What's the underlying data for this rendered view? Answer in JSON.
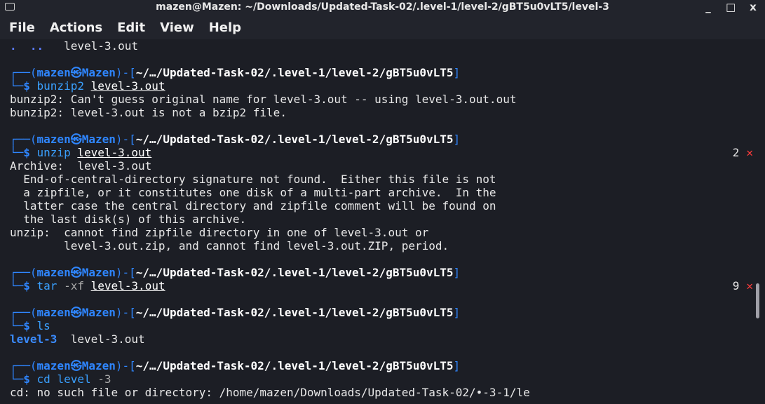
{
  "window": {
    "title": "mazen@Mazen: ~/Downloads/Updated-Task-02/.level-1/level-2/gBT5u0vLT5/level-3",
    "controls": [
      "_",
      "□",
      "x"
    ]
  },
  "menu": [
    "File",
    "Actions",
    "Edit",
    "View",
    "Help"
  ],
  "terminal": {
    "prompt_user": "mazen",
    "prompt_host": "Mazen",
    "prompt_at": "㉿",
    "prompt_path": "~/…/Updated-Task-02/.level-1/level-2/gBT5u0vLT5",
    "top_line": {
      "dots": ".  ..",
      "file": "level-3.out"
    },
    "blocks": [
      {
        "cmd": "bunzip2",
        "arg": "level-3.out",
        "status": "",
        "output": [
          "bunzip2: Can't guess original name for level-3.out -- using level-3.out.out",
          "bunzip2: level-3.out is not a bzip2 file."
        ]
      },
      {
        "cmd": "unzip",
        "arg": "level-3.out",
        "status": "2",
        "output": [
          "Archive:  level-3.out",
          "  End-of-central-directory signature not found.  Either this file is not",
          "  a zipfile, or it constitutes one disk of a multi-part archive.  In the",
          "  latter case the central directory and zipfile comment will be found on",
          "  the last disk(s) of this archive.",
          "unzip:  cannot find zipfile directory in one of level-3.out or",
          "        level-3.out.zip, and cannot find level-3.out.ZIP, period."
        ]
      },
      {
        "cmd": "tar",
        "arg": "level-3.out",
        "flag": "-xf",
        "status": "9",
        "output": []
      },
      {
        "cmd": "ls",
        "arg": "",
        "status": "",
        "ls_dir": "level-3",
        "ls_file": "level-3.out"
      },
      {
        "cmd": "cd",
        "arg": "level -3",
        "status": "",
        "output": [
          "cd: no such file or directory: /home/mazen/Downloads/Updated-Task-02/•-3-1/le"
        ]
      }
    ],
    "status_x": "✕"
  },
  "colors": {
    "accent": "#2f86ff",
    "error": "#ff3b3b",
    "background": "#1c1e25"
  }
}
